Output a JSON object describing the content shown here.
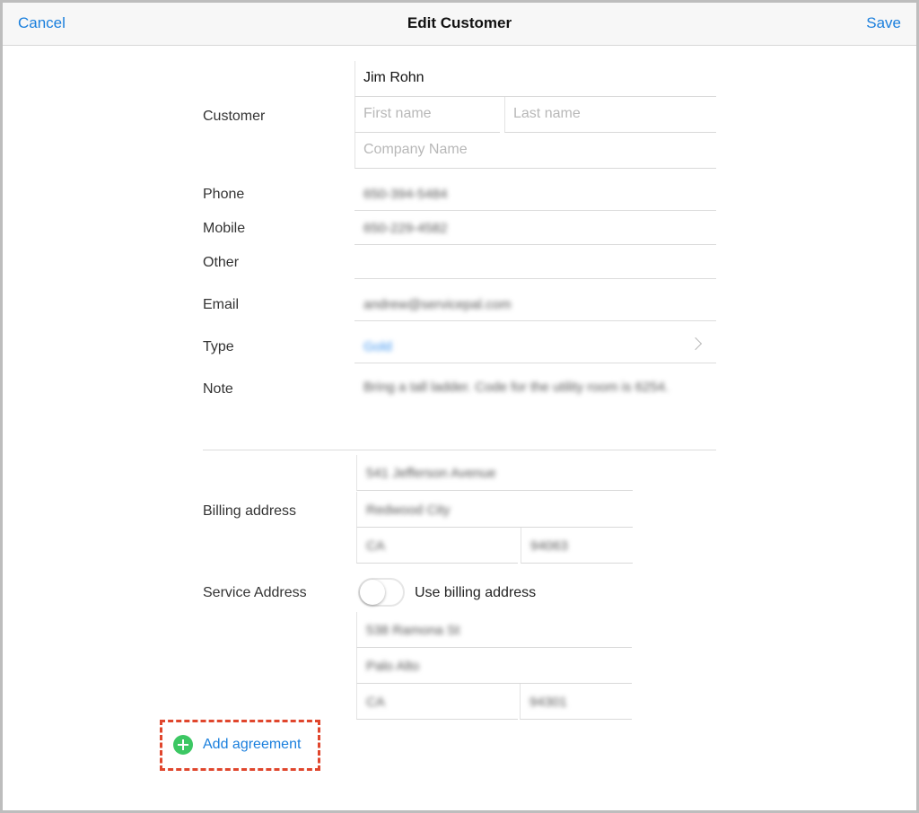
{
  "navbar": {
    "cancel": "Cancel",
    "title": "Edit Customer",
    "save": "Save"
  },
  "customer": {
    "label": "Customer",
    "display_name": "Jim Rohn",
    "first_name_placeholder": "First name",
    "last_name_placeholder": "Last name",
    "company_placeholder": "Company Name"
  },
  "phone": {
    "label": "Phone",
    "value": "650-394-5484"
  },
  "mobile": {
    "label": "Mobile",
    "value": "650-229-4582"
  },
  "other": {
    "label": "Other",
    "value": ""
  },
  "email": {
    "label": "Email",
    "value": "andrew@servicepal.com"
  },
  "type": {
    "label": "Type",
    "value": "Gold"
  },
  "note": {
    "label": "Note",
    "value": "Bring a tall ladder. Code for the utility room is 6254."
  },
  "billing": {
    "label": "Billing address",
    "street": "541 Jefferson Avenue",
    "city": "Redwood City",
    "state": "CA",
    "zip": "94063"
  },
  "service": {
    "label": "Service Address",
    "toggle_label": "Use billing address",
    "use_billing": false,
    "street": "538 Ramona St",
    "city": "Palo Alto",
    "state": "CA",
    "zip": "94301"
  },
  "add_agreement": {
    "label": "Add agreement",
    "highlight_color": "#e0462d"
  },
  "colors": {
    "accent": "#1a7fdd",
    "add_icon": "#3cc763"
  }
}
